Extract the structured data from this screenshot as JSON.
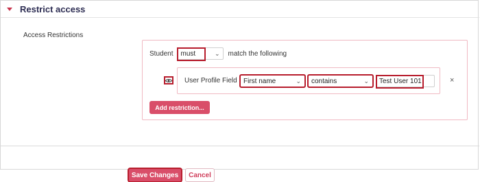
{
  "section": {
    "title": "Restrict access"
  },
  "access": {
    "label": "Access Restrictions"
  },
  "rule": {
    "prefix": "Student",
    "mode_selected": "must",
    "suffix": "match the following"
  },
  "condition": {
    "type_label": "User Profile Field",
    "field_selected": "First name",
    "operator_selected": "contains",
    "value": "Test User 101",
    "visibility_icon": "eye-icon",
    "remove_glyph": "×"
  },
  "buttons": {
    "add_restriction": "Add restriction...",
    "save": "Save Changes",
    "cancel": "Cancel"
  },
  "colors": {
    "accent": "#d94e69",
    "highlight": "#b71c2c",
    "title": "#2c2c52"
  }
}
